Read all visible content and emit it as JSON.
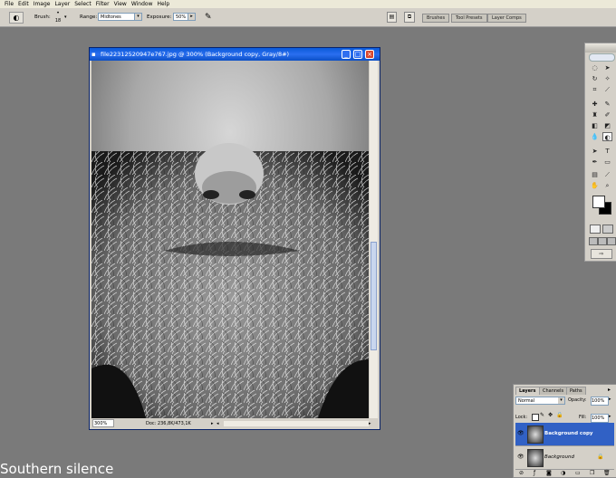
{
  "menu": [
    "File",
    "Edit",
    "Image",
    "Layer",
    "Select",
    "Filter",
    "View",
    "Window",
    "Help"
  ],
  "options": {
    "brush_label": "Brush:",
    "brush_size": "18",
    "range_label": "Range:",
    "range_value": "Midtones",
    "exposure_label": "Exposure:",
    "exposure_value": "50%"
  },
  "palette_well": [
    "Brushes",
    "Tool Presets",
    "Layer Comps"
  ],
  "document": {
    "title": "file22312520947е767.jpg @ 300% (Background copy, Gray/8#)",
    "zoom": "300%",
    "doc_info": "Doc: 236,8K/473,1K"
  },
  "layers_panel": {
    "tabs": [
      "Layers",
      "Channels",
      "Paths"
    ],
    "blend_mode": "Normal",
    "opacity_label": "Opacity:",
    "opacity_value": "100%",
    "lock_label": "Lock:",
    "fill_label": "Fill:",
    "fill_value": "100%",
    "layers": [
      {
        "name": "Background copy",
        "selected": true
      },
      {
        "name": "Background",
        "selected": false
      }
    ]
  },
  "caption": "Southern silence",
  "colors": {
    "workspace": "#7a7a7a",
    "titlebar": "#0a5ad8",
    "selected_layer": "#3161c5",
    "chrome": "#d4d0c8"
  }
}
